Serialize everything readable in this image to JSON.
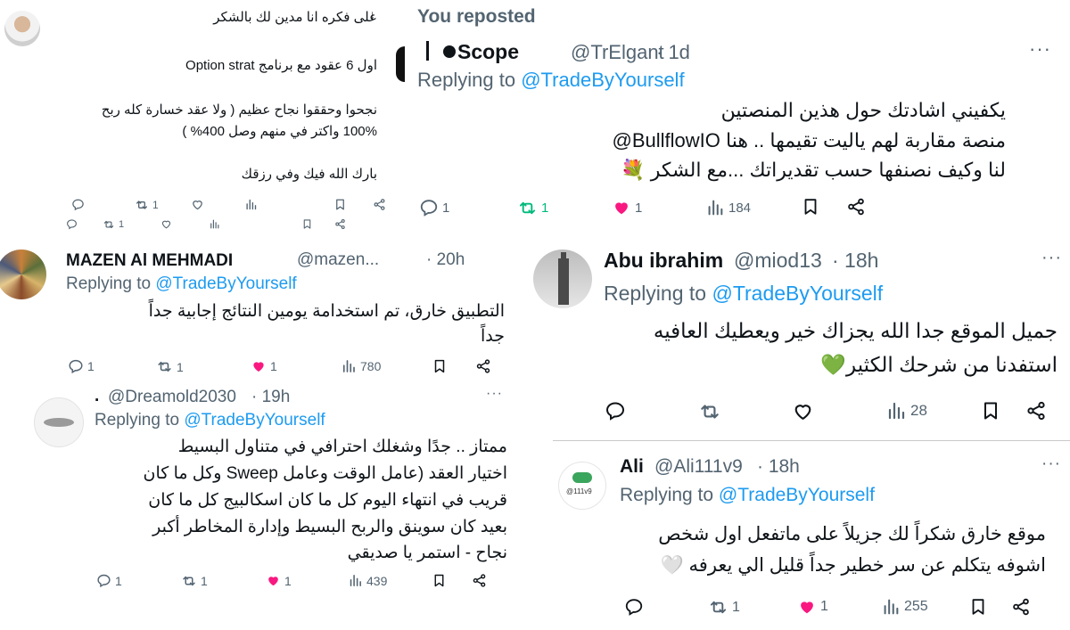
{
  "colors": {
    "accent": "#1d9bf0",
    "like": "#f91880",
    "repost": "#00ba7c",
    "muted": "#536471"
  },
  "tweet_top_left": {
    "lines": [
      "على فكره انا مدين لك بالشكر",
      "اول 6 عقود مع برنامج Option strat",
      "نجحوا وحققوا نجاح عظيم ( ولا عقد خسارة كله ربح",
      "100% واكتر في منهم وصل 400% )",
      "بارك الله فيك وفي رزقك"
    ],
    "actions": {
      "reply": "",
      "repost": "1",
      "like": "",
      "views": ""
    }
  },
  "tweet_scope": {
    "reposted_label": "You reposted",
    "name": "Scope",
    "handle": "@TrElgant",
    "time": "· 1d",
    "replying_prefix": "Replying to",
    "replying_handle": "@TradeByYourself",
    "lines": [
      "يكفيني اشادتك حول هذين المنصتين",
      "@BullflowIO منصة مقاربة لهم ياليت تقيمها .. هنا",
      "لنا وكيف نصنفها حسب تقديراتك ...مع الشكر 💐"
    ],
    "actions": {
      "reply": "1",
      "repost": "1",
      "like": "1",
      "views": "184"
    }
  },
  "tweet_mazen": {
    "name": "MAZEN Al MEHMADI",
    "handle": "@mazen...",
    "time": "· 20h",
    "replying_prefix": "Replying to",
    "replying_handle": "@TradeByYourself",
    "lines": [
      "التطبيق خارق،  تم استخدامة يومين النتائج إجابية جداً",
      "جداً"
    ],
    "actions": {
      "reply": "1",
      "repost": "1",
      "like": "1",
      "views": "780"
    }
  },
  "tweet_abu": {
    "name": "Abu ibrahim",
    "handle": "@miod13",
    "time": "· 18h",
    "replying_prefix": "Replying to",
    "replying_handle": "@TradeByYourself",
    "lines": [
      "جميل الموقع جدا الله يجزاك خير ويعطيك العافيه",
      "استفدنا من شرحك الكثير💚"
    ],
    "actions": {
      "reply": "",
      "repost": "",
      "like": "",
      "views": "28"
    }
  },
  "tweet_dream": {
    "name": ".",
    "handle": "@Dreamold2030",
    "time": "· 19h",
    "replying_prefix": "Replying to",
    "replying_handle": "@TradeByYourself",
    "lines": [
      "ممتاز .. جدًا وشغلك احترافي في متناول البسيط",
      "اختيار العقد (عامل الوقت وعامل Sweep وكل ما كان",
      "قريب في انتهاء اليوم كل ما كان اسكالبيج كل ما كان",
      "بعيد كان سوينق والربح البسيط وإدارة المخاطر أكبر",
      "نجاح - استمر يا صديقي"
    ],
    "actions": {
      "reply": "1",
      "repost": "1",
      "like": "1",
      "views": "439"
    }
  },
  "tweet_ali": {
    "name": "Ali",
    "handle": "@Ali111v9",
    "time": "· 18h",
    "avatar_text": "@111v9",
    "replying_prefix": "Replying to",
    "replying_handle": "@TradeByYourself",
    "lines": [
      "موقع خارق شكراً لك جزيلاً على ماتفعل اول شخص",
      "اشوفه يتكلم عن سر خطير جداً قليل الي يعرفه 🤍"
    ],
    "actions": {
      "reply": "",
      "repost": "1",
      "like": "1",
      "views": "255"
    }
  },
  "icons": [
    "reply-icon",
    "repost-icon",
    "like-icon",
    "views-icon",
    "bookmark-icon",
    "share-icon",
    "more-icon"
  ]
}
